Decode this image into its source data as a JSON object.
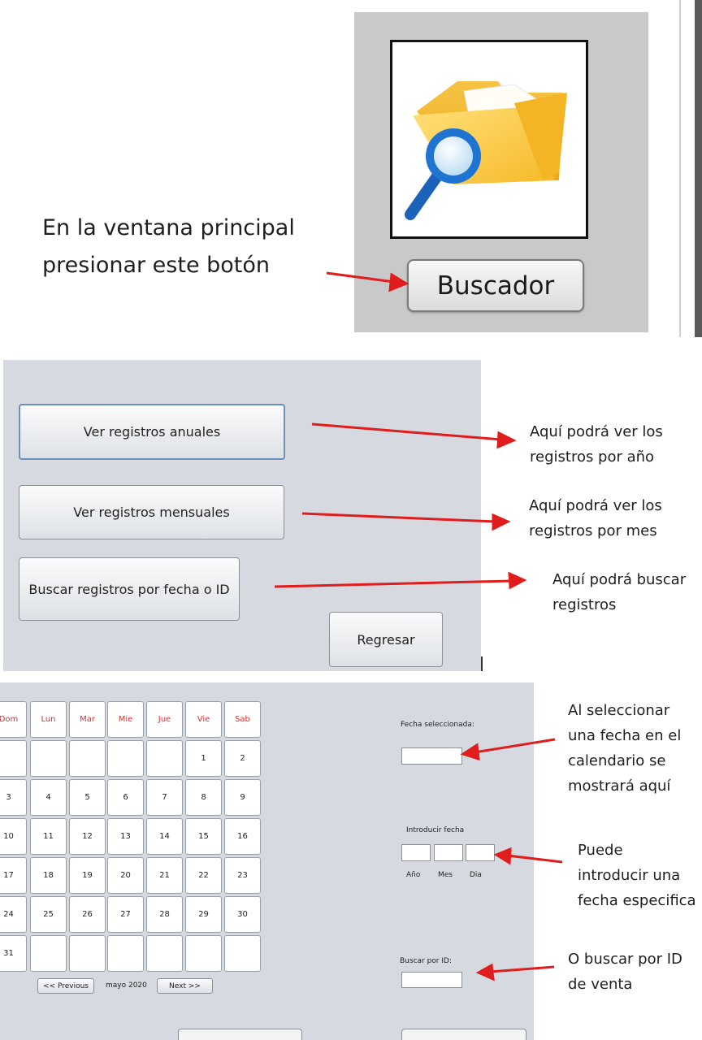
{
  "section1": {
    "instruction_line1": "En la ventana principal",
    "instruction_line2": "presionar este botón",
    "icon": "folder-search-icon",
    "button_label": "Buscador"
  },
  "section2": {
    "buttons": {
      "annual": "Ver registros anuales",
      "monthly": "Ver registros mensuales",
      "search": "Buscar registros por fecha o ID",
      "back": "Regresar"
    },
    "notes": {
      "annual_l1": "Aquí podrá ver los",
      "annual_l2": "registros por año",
      "monthly_l1": "Aquí podrá ver los",
      "monthly_l2": "registros por mes",
      "search_l1": "Aquí podrá buscar",
      "search_l2": "registros"
    }
  },
  "section3": {
    "weekdays": [
      "Dom",
      "Lun",
      "Mar",
      "Mie",
      "Jue",
      "Vie",
      "Sab"
    ],
    "weeks": [
      [
        "",
        "",
        "",
        "",
        "",
        "1",
        "2"
      ],
      [
        "3",
        "4",
        "5",
        "6",
        "7",
        "8",
        "9"
      ],
      [
        "10",
        "11",
        "12",
        "13",
        "14",
        "15",
        "16"
      ],
      [
        "17",
        "18",
        "19",
        "20",
        "21",
        "22",
        "23"
      ],
      [
        "24",
        "25",
        "26",
        "27",
        "28",
        "29",
        "30"
      ],
      [
        "31",
        "",
        "",
        "",
        "",
        "",
        ""
      ]
    ],
    "prev_label": "<< Previous",
    "month_label": "mayo 2020",
    "next_label": "Next >>",
    "selected_date_label": "Fecha seleccionada:",
    "enter_date_label": "Introducir fecha",
    "year_label": "Año",
    "month_field_label": "Mes",
    "day_label": "Dia",
    "search_id_label": "Buscar por ID:",
    "notes": {
      "sel_l1": "Al seleccionar",
      "sel_l2": "una fecha en el",
      "sel_l3": "calendario se",
      "sel_l4": "mostrará aquí",
      "enter_l1": "Puede",
      "enter_l2": "introducir una",
      "enter_l3": "fecha especifica",
      "id_l1": "O buscar por ID",
      "id_l2": "de venta"
    }
  },
  "colors": {
    "panel_gray": "#d6d9df",
    "arrow_red": "#e01c1c",
    "weekday_red": "#e32b2b"
  }
}
